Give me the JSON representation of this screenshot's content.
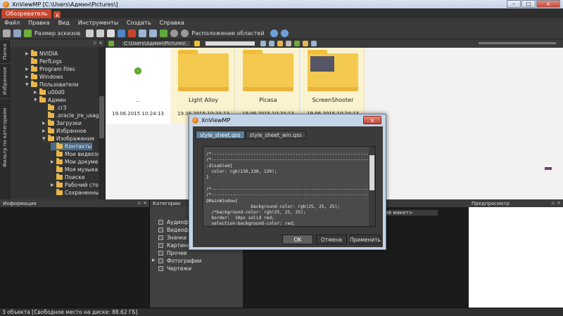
{
  "window": {
    "title": "XnViewMP [C:\\Users\\Админ\\Pictures\\]",
    "minimize": "–",
    "maximize": "□",
    "close": "x"
  },
  "tabs": {
    "browser_tab": "Обозреватель",
    "close": "x"
  },
  "menu": [
    "Файл",
    "Правка",
    "Вид",
    "Инструменты",
    "Создать",
    "Справка"
  ],
  "toolbar": {
    "thumb_size": "Размер эскизов",
    "layout": "Расположение областей"
  },
  "side_tabs": [
    "Папки",
    "Избранное",
    "Фильтр по категориям"
  ],
  "folders_panel": {
    "items": [
      "NVIDIA",
      "PerfLogs",
      "Program Files",
      "Windows",
      "Пользователи",
      "u00d0",
      "Админ",
      ".cr3",
      ".oracle_jre_usage",
      "Загрузки",
      "Избранное",
      "Изображения",
      "Контакты",
      "Мои видеозапис",
      "Мои документы",
      "Моя музыка",
      "Поиски",
      "Рабочий стол",
      "Сохраненные иг"
    ]
  },
  "address": {
    "path": "C:\\Users\\Админ\\Pictures\\"
  },
  "thumbnails": {
    "up": {
      "label": "..",
      "date": "19.06.2015 10:24:13"
    },
    "items": [
      {
        "label": "Light Alloy",
        "date": "19.06.2015 10:24:13"
      },
      {
        "label": "Picasa",
        "date": "19.06.2015 10:24:13"
      },
      {
        "label": "ScreenShooter",
        "date": "19.06.2015 10:24:13"
      }
    ]
  },
  "info_panel": {
    "title": "Информация"
  },
  "categories_panel": {
    "title": "Категории",
    "items": [
      "Аудиофа",
      "Видеофа",
      "Значки",
      "Картинк",
      "Прочее",
      "Фотографии",
      "Чертежи"
    ],
    "layout_select": "ий макет>"
  },
  "preview_panel": {
    "title": "Предпросмотр"
  },
  "status": {
    "text": "3 объекта [Свободное место на диске: 88.62 ГБ]"
  },
  "dialog": {
    "title": "XnViewMP",
    "close": "x",
    "tabs": [
      "style_sheet.qss",
      "style_sheet_win.qss"
    ],
    "code": [
      "/*-------------------------------------------------------------------*/",
      "/*-------------------------------------------------------------------*/",
      ":disabled{",
      "  color: rgb(130,130, 130);",
      "}",
      "",
      "/*-------------------------------------------------------------------*/",
      "/*-------------------------------------------------------------------*/",
      "QMainWindow{",
      "                 background-color: rgb(25, 25, 25);",
      "  /*background-color: rgb(25, 25, 25);",
      "  border:  10px solid red;",
      "  selection-background-color: red;"
    ],
    "ok": "OK",
    "cancel": "Отмена",
    "apply": "Применить"
  }
}
